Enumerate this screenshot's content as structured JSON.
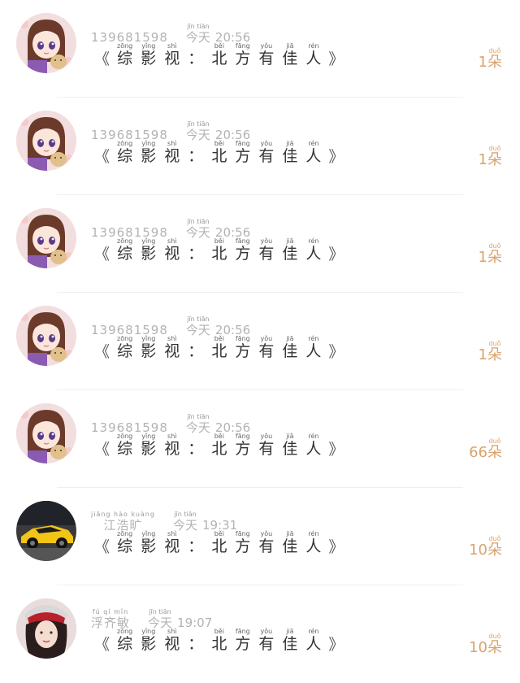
{
  "rows": [
    {
      "avatar": "anime-girl-avatar",
      "name": "139681598",
      "day": {
        "hz": "今天",
        "py": "jīn tiān"
      },
      "time": "20:56",
      "count": {
        "num": "1",
        "unit": "朵",
        "py": "duǒ"
      }
    },
    {
      "avatar": "anime-girl-avatar",
      "name": "139681598",
      "day": {
        "hz": "今天",
        "py": "jīn tiān"
      },
      "time": "20:56",
      "count": {
        "num": "1",
        "unit": "朵",
        "py": "duǒ"
      }
    },
    {
      "avatar": "anime-girl-avatar",
      "name": "139681598",
      "day": {
        "hz": "今天",
        "py": "jīn tiān"
      },
      "time": "20:56",
      "count": {
        "num": "1",
        "unit": "朵",
        "py": "duǒ"
      }
    },
    {
      "avatar": "anime-girl-avatar",
      "name": "139681598",
      "day": {
        "hz": "今天",
        "py": "jīn tiān"
      },
      "time": "20:56",
      "count": {
        "num": "1",
        "unit": "朵",
        "py": "duǒ"
      }
    },
    {
      "avatar": "anime-girl-avatar",
      "name": "139681598",
      "day": {
        "hz": "今天",
        "py": "jīn tiān"
      },
      "time": "20:56",
      "count": {
        "num": "66",
        "unit": "朵",
        "py": "duǒ"
      }
    },
    {
      "avatar": "yellow-car-avatar",
      "name": "江浩旷",
      "name_py": "jiāng hào kuàng",
      "day": {
        "hz": "今天",
        "py": "jīn tiān"
      },
      "time": "19:31",
      "count": {
        "num": "10",
        "unit": "朵",
        "py": "duǒ"
      }
    },
    {
      "avatar": "girl-photo-avatar",
      "name": "浮齐敏",
      "name_py": "fú qí mǐn",
      "day": {
        "hz": "今天",
        "py": "jīn tiān"
      },
      "time": "19:07",
      "count": {
        "num": "10",
        "unit": "朵",
        "py": "duǒ"
      }
    }
  ],
  "title": {
    "open_quote": "《",
    "close_quote": "》",
    "chars": [
      {
        "hz": "综",
        "py": "zōng"
      },
      {
        "hz": "影",
        "py": "yǐng"
      },
      {
        "hz": "视",
        "py": "shì"
      },
      {
        "hz": "：",
        "py": ""
      },
      {
        "hz": "北",
        "py": "běi"
      },
      {
        "hz": "方",
        "py": "fāng"
      },
      {
        "hz": "有",
        "py": "yǒu"
      },
      {
        "hz": "佳",
        "py": "jiā"
      },
      {
        "hz": "人",
        "py": "rén"
      }
    ]
  },
  "colors": {
    "count": "#d9a36d",
    "meta": "#b3b3b3",
    "title": "#333333",
    "separator": "#efefef"
  }
}
